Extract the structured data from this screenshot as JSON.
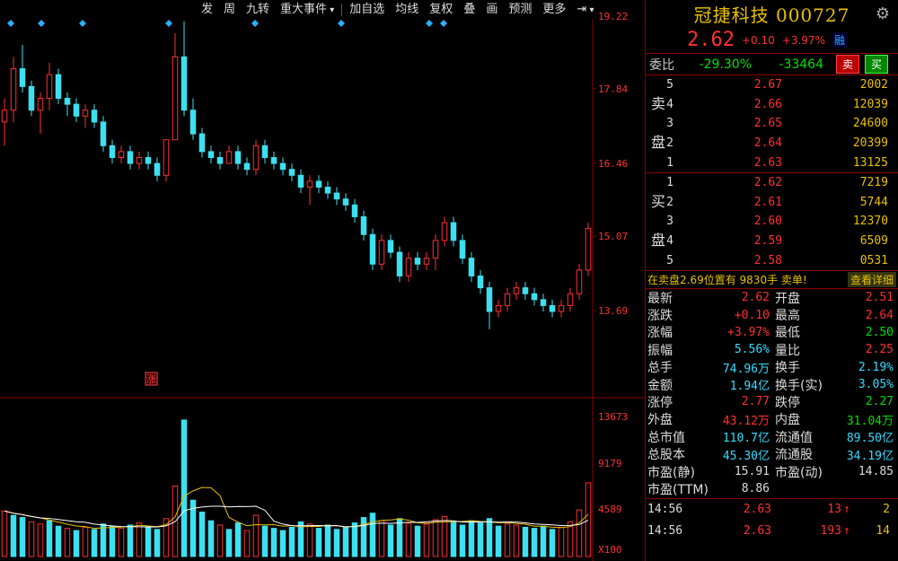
{
  "toolbar": {
    "items": [
      "发",
      "周",
      "九转",
      "重大事件",
      "加自选",
      "均线",
      "复权",
      "叠",
      "画",
      "预测",
      "更多"
    ],
    "nav_arrow": "⇥"
  },
  "stock": {
    "name_code": "冠捷科技 000727",
    "price": "2.62",
    "change": "+0.10",
    "change_pct": "+3.97%",
    "tag": "融"
  },
  "weibi": {
    "label": "委比",
    "ratio": "-29.30%",
    "diff": "-33464",
    "sell_btn": "卖",
    "buy_btn": "买"
  },
  "book": {
    "sell_side_label": [
      "卖",
      "盘"
    ],
    "buy_side_label": [
      "买",
      "盘"
    ],
    "sell": [
      {
        "n": "5",
        "price": "2.67",
        "qty": "2002"
      },
      {
        "n": "4",
        "price": "2.66",
        "qty": "12039"
      },
      {
        "n": "3",
        "price": "2.65",
        "qty": "24600"
      },
      {
        "n": "2",
        "price": "2.64",
        "qty": "20399"
      },
      {
        "n": "1",
        "price": "2.63",
        "qty": "13125"
      }
    ],
    "buy": [
      {
        "n": "1",
        "price": "2.62",
        "qty": "7219"
      },
      {
        "n": "2",
        "price": "2.61",
        "qty": "5744"
      },
      {
        "n": "3",
        "price": "2.60",
        "qty": "12370"
      },
      {
        "n": "4",
        "price": "2.59",
        "qty": "6509"
      },
      {
        "n": "5",
        "price": "2.58",
        "qty": "0531"
      }
    ]
  },
  "notice": {
    "text": "在卖盘2.69位置有 9830手 卖单!",
    "link": "查看详细"
  },
  "stats": [
    {
      "k": "最新",
      "v": "2.62",
      "vc": "red",
      "k2": "开盘",
      "v2": "2.51",
      "v2c": "red"
    },
    {
      "k": "涨跌",
      "v": "+0.10",
      "vc": "red",
      "k2": "最高",
      "v2": "2.64",
      "v2c": "red"
    },
    {
      "k": "涨幅",
      "v": "+3.97%",
      "vc": "red",
      "k2": "最低",
      "v2": "2.50",
      "v2c": "grn"
    },
    {
      "k": "振幅",
      "v": "5.56%",
      "vc": "cy",
      "k2": "量比",
      "v2": "2.25",
      "v2c": "red"
    },
    {
      "k": "总手",
      "v": "74.96万",
      "vc": "cy",
      "k2": "换手",
      "v2": "2.19%",
      "v2c": "cy"
    },
    {
      "k": "金额",
      "v": "1.94亿",
      "vc": "cy",
      "k2": "换手(实)",
      "v2": "3.05%",
      "v2c": "cy"
    },
    {
      "k": "涨停",
      "v": "2.77",
      "vc": "red",
      "k2": "跌停",
      "v2": "2.27",
      "v2c": "grn"
    },
    {
      "k": "外盘",
      "v": "43.12万",
      "vc": "red",
      "k2": "内盘",
      "v2": "31.04万",
      "v2c": "grn"
    },
    {
      "k": "总市值",
      "v": "110.7亿",
      "vc": "cy",
      "k2": "流通值",
      "v2": "89.50亿",
      "v2c": "cy"
    },
    {
      "k": "总股本",
      "v": "45.30亿",
      "vc": "cy",
      "k2": "流通股",
      "v2": "34.19亿",
      "v2c": "cy"
    },
    {
      "k": "市盈(静)",
      "v": "15.91",
      "vc": "wh",
      "k2": "市盈(动)",
      "v2": "14.85",
      "v2c": "wh"
    },
    {
      "k": "市盈(TTM)",
      "v": "8.86",
      "vc": "wh",
      "k2": "",
      "v2": "",
      "v2c": "wh"
    }
  ],
  "ticks": [
    {
      "time": "14:56",
      "price": "2.63",
      "vol": "13",
      "arrow": "↑",
      "num": "2"
    },
    {
      "time": "14:56",
      "price": "2.63",
      "vol": "193",
      "arrow": "↑",
      "num": "14"
    }
  ],
  "chart_data": {
    "type": "candlestick",
    "price_axis_labels": [
      "19.22",
      "17.84",
      "16.46",
      "15.07",
      "13.69"
    ],
    "volume_axis_labels": [
      "13673",
      "9179",
      "4589",
      "X100"
    ],
    "annotation": "涨",
    "candles": [
      [
        3.5,
        3.9,
        3.1,
        3.7
      ],
      [
        3.7,
        4.6,
        3.5,
        4.4
      ],
      [
        4.4,
        4.8,
        4.0,
        4.1
      ],
      [
        4.1,
        4.2,
        3.6,
        3.7
      ],
      [
        3.7,
        4.0,
        3.3,
        3.9
      ],
      [
        3.9,
        4.5,
        3.7,
        4.3
      ],
      [
        4.3,
        4.4,
        3.8,
        3.9
      ],
      [
        3.9,
        4.0,
        3.6,
        3.8
      ],
      [
        3.8,
        3.9,
        3.5,
        3.6
      ],
      [
        3.6,
        3.8,
        3.4,
        3.7
      ],
      [
        3.7,
        3.8,
        3.4,
        3.5
      ],
      [
        3.5,
        3.6,
        3.0,
        3.1
      ],
      [
        3.1,
        3.2,
        2.8,
        2.9
      ],
      [
        2.9,
        3.1,
        2.8,
        3.0
      ],
      [
        3.0,
        3.1,
        2.7,
        2.8
      ],
      [
        2.8,
        3.0,
        2.7,
        2.9
      ],
      [
        2.9,
        3.0,
        2.7,
        2.8
      ],
      [
        2.8,
        2.9,
        2.5,
        2.6
      ],
      [
        2.6,
        3.2,
        2.5,
        3.2
      ],
      [
        3.2,
        5.0,
        3.2,
        4.6
      ],
      [
        4.6,
        5.2,
        3.6,
        3.7
      ],
      [
        3.7,
        3.9,
        3.2,
        3.3
      ],
      [
        3.3,
        3.4,
        2.9,
        3.0
      ],
      [
        3.0,
        3.1,
        2.8,
        2.9
      ],
      [
        2.9,
        3.0,
        2.7,
        2.8
      ],
      [
        2.8,
        3.1,
        2.8,
        3.0
      ],
      [
        3.0,
        3.1,
        2.7,
        2.8
      ],
      [
        2.8,
        2.9,
        2.6,
        2.7
      ],
      [
        2.7,
        3.2,
        2.6,
        3.1
      ],
      [
        3.1,
        3.2,
        2.8,
        2.9
      ],
      [
        2.9,
        3.0,
        2.7,
        2.8
      ],
      [
        2.8,
        2.9,
        2.6,
        2.7
      ],
      [
        2.7,
        2.8,
        2.5,
        2.6
      ],
      [
        2.6,
        2.7,
        2.3,
        2.4
      ],
      [
        2.4,
        2.6,
        2.1,
        2.5
      ],
      [
        2.5,
        2.6,
        2.3,
        2.4
      ],
      [
        2.4,
        2.5,
        2.2,
        2.3
      ],
      [
        2.3,
        2.4,
        2.1,
        2.2
      ],
      [
        2.2,
        2.3,
        2.0,
        2.1
      ],
      [
        2.1,
        2.2,
        1.8,
        1.9
      ],
      [
        1.9,
        2.0,
        1.5,
        1.6
      ],
      [
        1.6,
        1.7,
        1.0,
        1.1
      ],
      [
        1.1,
        1.6,
        1.0,
        1.5
      ],
      [
        1.5,
        1.6,
        1.2,
        1.3
      ],
      [
        1.3,
        1.4,
        0.8,
        0.9
      ],
      [
        0.9,
        1.3,
        0.8,
        1.2
      ],
      [
        1.2,
        1.3,
        1.0,
        1.1
      ],
      [
        1.1,
        1.3,
        1.0,
        1.2
      ],
      [
        1.2,
        1.6,
        1.0,
        1.5
      ],
      [
        1.5,
        1.9,
        1.4,
        1.8
      ],
      [
        1.8,
        1.9,
        1.4,
        1.5
      ],
      [
        1.5,
        1.6,
        1.1,
        1.2
      ],
      [
        1.2,
        1.3,
        0.8,
        0.9
      ],
      [
        0.9,
        1.0,
        0.6,
        0.7
      ],
      [
        0.7,
        0.8,
        0.0,
        0.3
      ],
      [
        0.3,
        0.5,
        0.2,
        0.4
      ],
      [
        0.4,
        0.7,
        0.3,
        0.6
      ],
      [
        0.6,
        0.8,
        0.5,
        0.7
      ],
      [
        0.7,
        0.8,
        0.5,
        0.6
      ],
      [
        0.6,
        0.7,
        0.4,
        0.5
      ],
      [
        0.5,
        0.6,
        0.3,
        0.4
      ],
      [
        0.4,
        0.5,
        0.2,
        0.3
      ],
      [
        0.3,
        0.5,
        0.2,
        0.4
      ],
      [
        0.4,
        0.7,
        0.3,
        0.6
      ],
      [
        0.6,
        1.1,
        0.5,
        1.0
      ],
      [
        1.0,
        1.8,
        0.9,
        1.7
      ]
    ],
    "volumes": [
      [
        4200,
        1
      ],
      [
        3800,
        0
      ],
      [
        3600,
        0
      ],
      [
        3200,
        1
      ],
      [
        3000,
        1
      ],
      [
        3300,
        0
      ],
      [
        2800,
        0
      ],
      [
        2600,
        1
      ],
      [
        2400,
        0
      ],
      [
        2700,
        1
      ],
      [
        2500,
        0
      ],
      [
        3000,
        0
      ],
      [
        2800,
        0
      ],
      [
        2600,
        1
      ],
      [
        2900,
        0
      ],
      [
        3100,
        1
      ],
      [
        2700,
        0
      ],
      [
        2500,
        0
      ],
      [
        3500,
        1
      ],
      [
        6500,
        1
      ],
      [
        12600,
        0
      ],
      [
        5200,
        0
      ],
      [
        4100,
        0
      ],
      [
        3300,
        0
      ],
      [
        2900,
        1
      ],
      [
        2500,
        0
      ],
      [
        3100,
        0
      ],
      [
        2400,
        1
      ],
      [
        3800,
        1
      ],
      [
        2800,
        0
      ],
      [
        2600,
        0
      ],
      [
        2400,
        0
      ],
      [
        2700,
        0
      ],
      [
        3200,
        0
      ],
      [
        3000,
        1
      ],
      [
        2600,
        0
      ],
      [
        2900,
        0
      ],
      [
        2500,
        0
      ],
      [
        2700,
        0
      ],
      [
        3100,
        0
      ],
      [
        3600,
        0
      ],
      [
        4000,
        0
      ],
      [
        3300,
        1
      ],
      [
        2900,
        0
      ],
      [
        3500,
        0
      ],
      [
        3100,
        1
      ],
      [
        2800,
        0
      ],
      [
        3000,
        1
      ],
      [
        3400,
        1
      ],
      [
        3700,
        1
      ],
      [
        3200,
        0
      ],
      [
        2900,
        0
      ],
      [
        3300,
        0
      ],
      [
        3100,
        0
      ],
      [
        3500,
        0
      ],
      [
        2800,
        0
      ],
      [
        3000,
        1
      ],
      [
        2900,
        1
      ],
      [
        2700,
        0
      ],
      [
        2600,
        0
      ],
      [
        2800,
        0
      ],
      [
        2500,
        0
      ],
      [
        2700,
        1
      ],
      [
        3200,
        1
      ],
      [
        4300,
        1
      ],
      [
        6800,
        1
      ]
    ]
  }
}
